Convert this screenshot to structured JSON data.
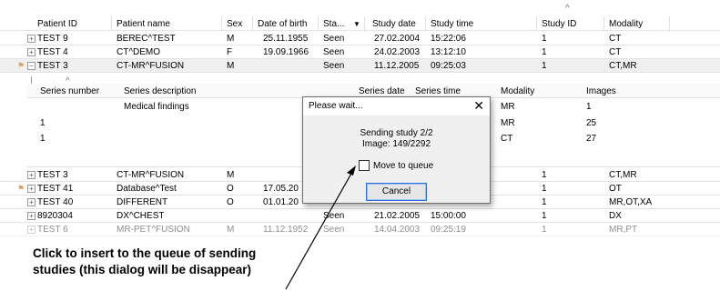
{
  "columns": {
    "patient_id": "Patient ID",
    "patient_name": "Patient name",
    "sex": "Sex",
    "dob": "Date of birth",
    "status": "Sta...",
    "study_date": "Study date",
    "study_time": "Study time",
    "study_id": "Study ID",
    "modality": "Modality"
  },
  "rows": [
    {
      "id": "TEST 9",
      "name": "BEREC^TEST",
      "sex": "M",
      "dob": "25.11.1955",
      "status": "Seen",
      "date": "27.02.2004",
      "time": "15:22:06",
      "study_id": "1",
      "modality": "CT"
    },
    {
      "id": "TEST 4",
      "name": "CT^DEMO",
      "sex": "F",
      "dob": "19.09.1966",
      "status": "Seen",
      "date": "24.02.2003",
      "time": "13:12:10",
      "study_id": "1",
      "modality": "CT"
    },
    {
      "id": "TEST 3",
      "name": "CT-MR^FUSION",
      "sex": "M",
      "dob": "",
      "status": "Seen",
      "date": "11.12.2005",
      "time": "09:25:03",
      "study_id": "1",
      "modality": "CT,MR"
    }
  ],
  "series": {
    "columns": {
      "number": "Series number",
      "description": "Series description",
      "date": "Series date",
      "time": "Series time",
      "modality": "Modality",
      "images": "Images"
    },
    "rows": [
      {
        "number": "",
        "description": "Medical findings",
        "modality": "MR",
        "images": "1"
      },
      {
        "number": "1",
        "description": "",
        "modality": "MR",
        "images": "25"
      },
      {
        "number": "1",
        "description": "",
        "modality": "CT",
        "images": "27"
      }
    ]
  },
  "rows_below": [
    {
      "id": "TEST 3",
      "name": "CT-MR^FUSION",
      "sex": "M",
      "dob": "",
      "status": "",
      "date": "",
      "time": "",
      "study_id": "1",
      "modality": "CT,MR"
    },
    {
      "id": "TEST 41",
      "name": "Database^Test",
      "sex": "O",
      "dob": "17.05.20",
      "status": "",
      "date": "",
      "time": "",
      "study_id": "1",
      "modality": "OT"
    },
    {
      "id": "TEST 40",
      "name": "DIFFERENT",
      "sex": "O",
      "dob": "01.01.20",
      "status": "",
      "date": "",
      "time": "",
      "study_id": "1",
      "modality": "MR,OT,XA"
    },
    {
      "id": "8920304",
      "name": "DX^CHEST",
      "sex": "",
      "dob": "",
      "status": "Seen",
      "date": "21.02.2005",
      "time": "15:00:00",
      "study_id": "1",
      "modality": "DX"
    },
    {
      "id": "TEST 6",
      "name": "MR-PET^FUSION",
      "sex": "M",
      "dob": "11.12.1952",
      "status": "Seen",
      "date": "14.04.2003",
      "time": "09:25:19",
      "study_id": "1",
      "modality": "MR,PT"
    }
  ],
  "dialog": {
    "title": "Please wait...",
    "close": "✕",
    "line1": "Sending study 2/2",
    "line2": "Image: 149/2292",
    "checkbox_label": "Move to queue",
    "cancel": "Cancel"
  },
  "annotation": {
    "line1": "Click to insert to the queue of sending",
    "line2": "studies (this dialog will be disappear)"
  }
}
